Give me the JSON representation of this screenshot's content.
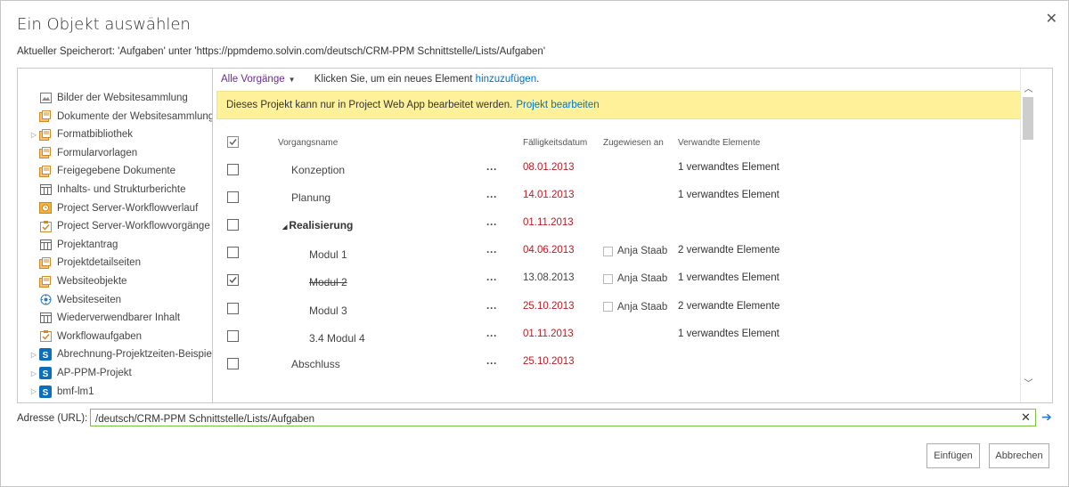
{
  "dialog": {
    "title": "Ein Objekt auswählen",
    "close_glyph": "✕",
    "location": "Aktueller Speicherort: 'Aufgaben' unter 'https://ppmdemo.solvin.com/deutsch/CRM-PPM Schnittstelle/Lists/Aufgaben'"
  },
  "tree": [
    {
      "label": "Bilder der Websitesammlung",
      "icon": "picture-library-icon",
      "expandable": false
    },
    {
      "label": "Dokumente der Websitesammlung",
      "icon": "document-library-icon",
      "expandable": false
    },
    {
      "label": "Formatbibliothek",
      "icon": "document-library-icon",
      "expandable": true
    },
    {
      "label": "Formularvorlagen",
      "icon": "document-library-icon",
      "expandable": false
    },
    {
      "label": "Freigegebene Dokumente",
      "icon": "document-library-icon",
      "expandable": false
    },
    {
      "label": "Inhalts- und Strukturberichte",
      "icon": "list-icon",
      "expandable": false
    },
    {
      "label": "Project Server-Workflowverlauf",
      "icon": "workflow-history-icon",
      "expandable": false
    },
    {
      "label": "Project Server-Workflowvorgänge",
      "icon": "task-list-icon",
      "expandable": false
    },
    {
      "label": "Projektantrag",
      "icon": "list-icon",
      "expandable": false
    },
    {
      "label": "Projektdetailseiten",
      "icon": "document-library-icon",
      "expandable": false
    },
    {
      "label": "Websiteobjekte",
      "icon": "document-library-icon",
      "expandable": false
    },
    {
      "label": "Websiteseiten",
      "icon": "site-pages-icon",
      "expandable": false
    },
    {
      "label": "Wiederverwendbarer Inhalt",
      "icon": "list-icon",
      "expandable": false
    },
    {
      "label": "Workflowaufgaben",
      "icon": "task-list-icon",
      "expandable": false
    },
    {
      "label": "Abrechnung-Projektzeiten-Beispiel",
      "icon": "sharepoint-site-icon",
      "expandable": true
    },
    {
      "label": "AP-PPM-Projekt",
      "icon": "sharepoint-site-icon",
      "expandable": true
    },
    {
      "label": "bmf-lm1",
      "icon": "sharepoint-site-icon",
      "expandable": true
    }
  ],
  "view": {
    "selector": "Alle Vorgänge",
    "hint_prefix": "Klicken Sie, um ein neues Element",
    "hint_link": "hinzuzufügen",
    "hint_suffix": "."
  },
  "banner": {
    "message": "Dieses Projekt kann nur in Project Web App bearbeitet werden.",
    "link": "Projekt bearbeiten"
  },
  "columns": {
    "name": "Vorgangsname",
    "due": "Fälligkeitsdatum",
    "assigned": "Zugewiesen an",
    "related": "Verwandte Elemente"
  },
  "tasks": [
    {
      "name": "Konzeption",
      "due": "08.01.2013",
      "overdue": true,
      "assigned": "",
      "related": "1 verwandtes Element",
      "checked": false,
      "level": 1,
      "summary": false,
      "strike": false
    },
    {
      "name": "Planung",
      "due": "14.01.2013",
      "overdue": true,
      "assigned": "",
      "related": "1 verwandtes Element",
      "checked": false,
      "level": 1,
      "summary": false,
      "strike": false
    },
    {
      "name": "Realisierung",
      "due": "01.11.2013",
      "overdue": true,
      "assigned": "",
      "related": "",
      "checked": false,
      "level": 1,
      "summary": true,
      "strike": false
    },
    {
      "name": "Modul 1",
      "due": "04.06.2013",
      "overdue": true,
      "assigned": "Anja Staab",
      "related": "2 verwandte Elemente",
      "checked": false,
      "level": 2,
      "summary": false,
      "strike": false
    },
    {
      "name": "Modul 2",
      "due": "13.08.2013",
      "overdue": false,
      "assigned": "Anja Staab",
      "related": "1 verwandtes Element",
      "checked": true,
      "level": 2,
      "summary": false,
      "strike": true
    },
    {
      "name": "Modul 3",
      "due": "25.10.2013",
      "overdue": true,
      "assigned": "Anja Staab",
      "related": "2 verwandte Elemente",
      "checked": false,
      "level": 2,
      "summary": false,
      "strike": false
    },
    {
      "name": "3.4 Modul 4",
      "due": "01.11.2013",
      "overdue": true,
      "assigned": "",
      "related": "1 verwandtes Element",
      "checked": false,
      "level": 2,
      "summary": false,
      "strike": false
    },
    {
      "name": "Abschluss",
      "due": "25.10.2013",
      "overdue": true,
      "assigned": "",
      "related": "",
      "checked": false,
      "level": 1,
      "summary": false,
      "strike": false
    }
  ],
  "address": {
    "label": "Adresse (URL):",
    "value": "/deutsch/CRM-PPM Schnittstelle/Lists/Aufgaben",
    "clear_glyph": "✕",
    "go_glyph": "➔"
  },
  "buttons": {
    "insert": "Einfügen",
    "cancel": "Abbrechen"
  },
  "colors": {
    "accent": "#0072c6",
    "view_selector": "#6b2c91",
    "overdue": "#b91b24",
    "banner": "#fff199",
    "address_border": "#7ac143"
  }
}
